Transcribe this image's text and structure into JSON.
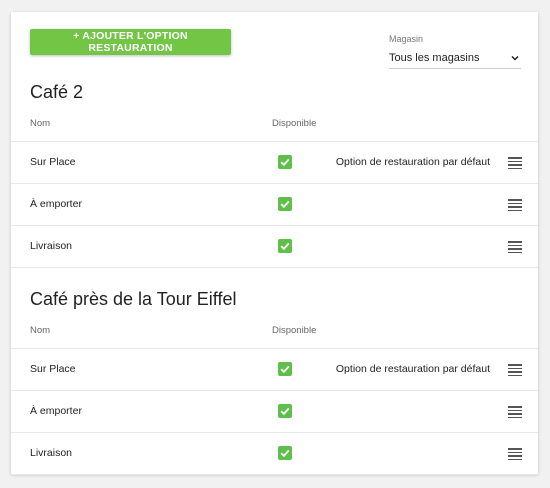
{
  "toolbar": {
    "add_button_label": "+ AJOUTER L'OPTION RESTAURATION"
  },
  "store_filter": {
    "label": "Magasin",
    "selected": "Tous les magasins"
  },
  "columns": {
    "name": "Nom",
    "available": "Disponible"
  },
  "default_option_label": "Option de restauration par défaut",
  "stores": [
    {
      "name": "Café 2",
      "options": [
        {
          "name": "Sur Place",
          "available": true,
          "is_default": true
        },
        {
          "name": "À emporter",
          "available": true,
          "is_default": false
        },
        {
          "name": "Livraison",
          "available": true,
          "is_default": false
        }
      ]
    },
    {
      "name": "Café près de la Tour Eiffel",
      "options": [
        {
          "name": "Sur Place",
          "available": true,
          "is_default": true
        },
        {
          "name": "À emporter",
          "available": true,
          "is_default": false
        },
        {
          "name": "Livraison",
          "available": true,
          "is_default": false
        }
      ]
    }
  ],
  "colors": {
    "accent": "#72c545",
    "checkbox": "#5ec04a"
  }
}
